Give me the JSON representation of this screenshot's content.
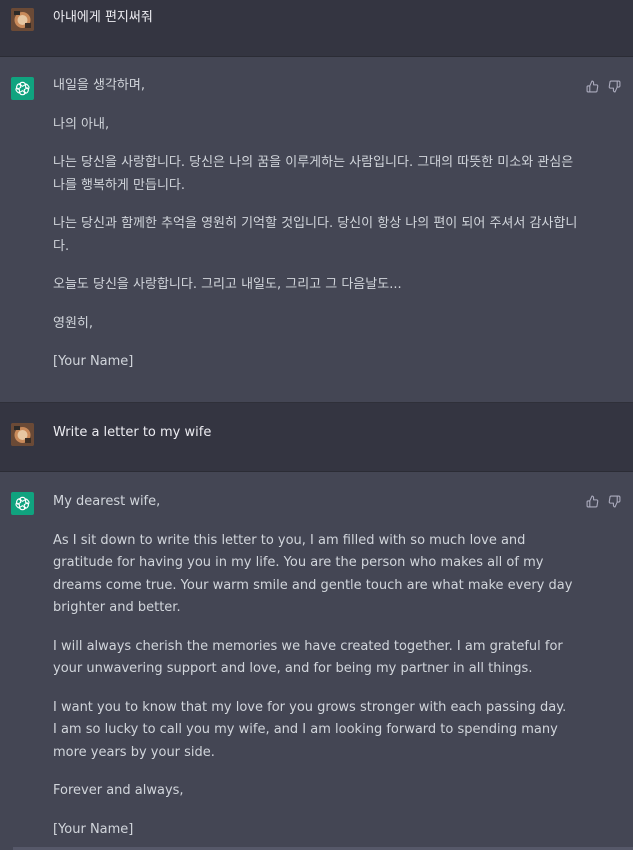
{
  "conversation": [
    {
      "role": "user",
      "text": "아내에게 편지써줘"
    },
    {
      "role": "assistant",
      "paragraphs": [
        "내일을 생각하며,",
        "나의 아내,",
        "나는 당신을 사랑합니다. 당신은 나의 꿈을 이루게하는 사람입니다. 그대의 따뜻한 미소와 관심은 나를 행복하게 만듭니다.",
        "나는 당신과 함께한 추억을 영원히 기억할 것입니다. 당신이 항상 나의 편이 되어 주셔서 감사합니다.",
        "오늘도 당신을 사랑합니다. 그리고 내일도, 그리고 그 다음날도...",
        "영원히,",
        "[Your Name]"
      ]
    },
    {
      "role": "user",
      "text": "Write a letter to my wife"
    },
    {
      "role": "assistant",
      "paragraphs": [
        "My dearest wife,",
        "As I sit down to write this letter to you, I am filled with so much love and gratitude for having you in my life. You are the person who makes all of my dreams come true. Your warm smile and gentle touch are what make every day brighter and better.",
        "I will always cherish the memories we have created together. I am grateful for your unwavering support and love, and for being my partner in all things.",
        "I want you to know that my love for you grows stronger with each passing day. I am so lucky to call you my wife, and I am looking forward to spending many more years by your side.",
        "Forever and always,",
        "[Your Name]"
      ]
    }
  ],
  "icons": {
    "user_avatar": "user-avatar-photo",
    "assistant_avatar": "openai-logo-icon",
    "thumbs_up": "thumbs-up-icon",
    "thumbs_down": "thumbs-down-icon"
  },
  "colors": {
    "user_bg": "#343541",
    "assistant_bg": "#444654",
    "assistant_avatar_bg": "#10a37f",
    "text": "#d1d5db"
  }
}
